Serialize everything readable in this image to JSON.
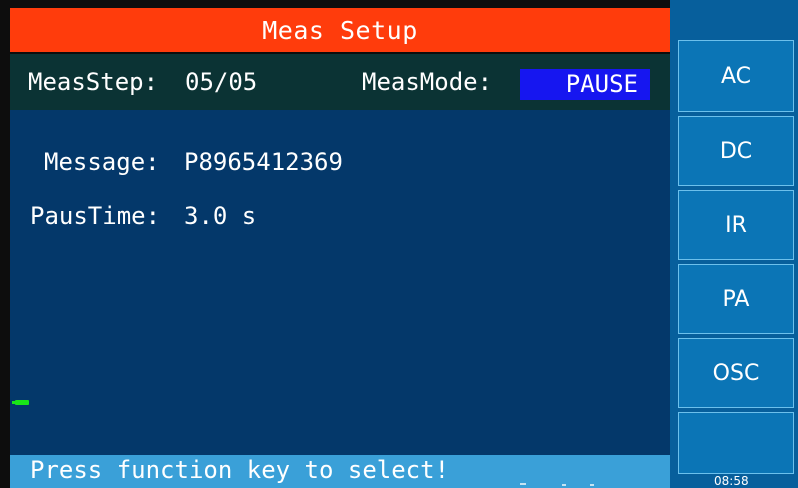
{
  "title": "Meas Setup",
  "step_bar": {
    "step_label": "MeasStep:",
    "step_value": "05/05",
    "mode_label": "MeasMode:",
    "mode_value": "PAUSE"
  },
  "main": {
    "message_label": "Message:",
    "message_value": "P8965412369",
    "paus_label": "PausTime:",
    "paus_value": "3.0 s"
  },
  "status": {
    "text": "Press function key to select!"
  },
  "function_keys": [
    "AC",
    "DC",
    "IR",
    "PA",
    "OSC",
    ""
  ],
  "side_glyph": "(",
  "clock": "08:58",
  "colors": {
    "title_bg": "#ff3c0c",
    "step_bar_bg": "#0b3334",
    "mode_highlight": "#1616f0",
    "main_bg": "#04386a",
    "status_bg": "#3aa0d8",
    "key_bg": "#0b75b6"
  }
}
